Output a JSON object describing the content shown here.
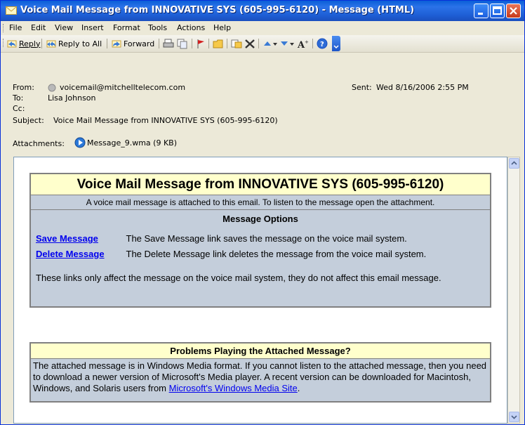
{
  "window": {
    "title": "Voice Mail Message from INNOVATIVE SYS (605-995-6120) - Message (HTML)"
  },
  "menu": [
    "File",
    "Edit",
    "View",
    "Insert",
    "Format",
    "Tools",
    "Actions",
    "Help"
  ],
  "toolbar": {
    "reply": "Reply",
    "reply_all": "Reply to All",
    "forward": "Forward"
  },
  "header": {
    "from_label": "From:",
    "from_value": "voicemail@mitchelltelecom.com",
    "sent_label": "Sent:",
    "sent_value": "Wed 8/16/2006 2:55 PM",
    "to_label": "To:",
    "to_value": "Lisa Johnson",
    "cc_label": "Cc:",
    "subject_label": "Subject:",
    "subject_value": "Voice Mail Message from INNOVATIVE SYS (605-995-6120)",
    "attachments_label": "Attachments:",
    "attachment_name": "Message_9.wma (9 KB)"
  },
  "body": {
    "heading": "Voice Mail Message from INNOVATIVE SYS (605-995-6120)",
    "intro": "A voice mail message is attached to this email. To listen to the message open the attachment.",
    "options_title": "Message Options",
    "save_link": "Save Message",
    "save_desc": "The Save Message link saves the message on the voice mail system.",
    "delete_link": "Delete Message",
    "delete_desc": "The Delete Message link deletes the message from the voice mail system.",
    "note": "These links only affect the message on the voice mail system, they do not affect this email message.",
    "problems_title": "Problems Playing the Attached Message?",
    "problems_text": "The attached message is in Windows Media format. If you cannot listen to the attached message, then you need to download a newer version of Microsoft's Media player. A recent version can be downloaded for Macintosh, Windows, and Solaris users from",
    "problems_link": "Microsoft's Windows Media Site",
    "problems_end": "."
  }
}
